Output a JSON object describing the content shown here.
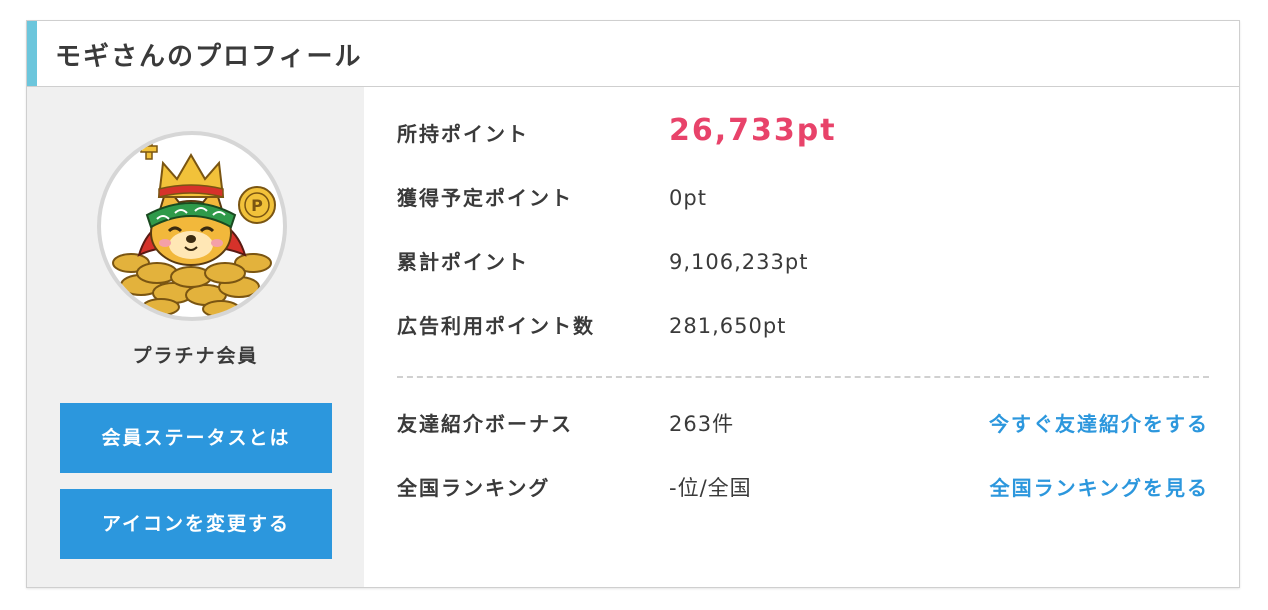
{
  "profile": {
    "title": "モギさんのプロフィール",
    "rank": "プラチナ会員",
    "avatar_icon": "crowned-shiba-coins-icon",
    "buttons": {
      "status_label": "会員ステータスとは",
      "change_icon_label": "アイコンを変更する"
    }
  },
  "points": {
    "held": {
      "label": "所持ポイント",
      "value": "26,733pt"
    },
    "pending": {
      "label": "獲得予定ポイント",
      "value": "0pt"
    },
    "total": {
      "label": "累計ポイント",
      "value": "9,106,233pt"
    },
    "ad_used": {
      "label": "広告利用ポイント数",
      "value": "281,650pt"
    }
  },
  "social": {
    "friend_bonus": {
      "label": "友達紹介ボーナス",
      "value": "263件",
      "link": "今すぐ友達紹介をする"
    },
    "ranking": {
      "label": "全国ランキング",
      "value": "-位/全国",
      "link": "全国ランキングを見る"
    }
  },
  "colors": {
    "accent": "#6cc6dc",
    "button": "#2c97dd",
    "link": "#2c97dd",
    "highlight": "#e8436a"
  }
}
